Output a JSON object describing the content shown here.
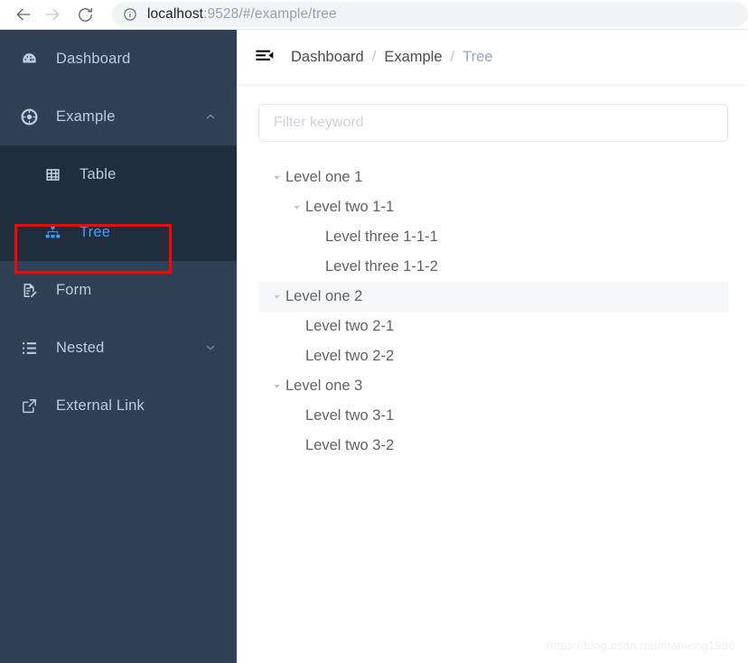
{
  "browser": {
    "back_icon": "arrow-left-icon",
    "forward_icon": "arrow-right-icon",
    "reload_icon": "reload-icon",
    "info_icon": "info-circle-icon",
    "url_host": "localhost",
    "url_rest": ":9528/#/example/tree",
    "url_full": "localhost:9528/#/example/tree"
  },
  "sidebar": {
    "background": "#304156",
    "submenu_background": "#1f2d3d",
    "active_color": "#409eff",
    "items": [
      {
        "label": "Dashboard",
        "icon": "dashboard-gauge-icon",
        "arrow": ""
      },
      {
        "label": "Example",
        "icon": "lifebuoy-icon",
        "arrow": "chevron-up-icon"
      },
      {
        "label": "Table",
        "icon": "table-grid-icon",
        "arrow": ""
      },
      {
        "label": "Tree",
        "icon": "sitemap-tree-icon",
        "arrow": ""
      },
      {
        "label": "Form",
        "icon": "document-edit-icon",
        "arrow": ""
      },
      {
        "label": "Nested",
        "icon": "nested-list-icon",
        "arrow": "chevron-down-icon"
      },
      {
        "label": "External Link",
        "icon": "external-link-icon",
        "arrow": ""
      }
    ],
    "annotation_color": "#ff0000"
  },
  "navbar": {
    "hamburger_icon": "menu-collapse-icon",
    "breadcrumb": [
      {
        "label": "Dashboard",
        "current": false
      },
      {
        "label": "Example",
        "current": false
      },
      {
        "label": "Tree",
        "current": true
      }
    ],
    "separator": "/"
  },
  "filter": {
    "placeholder": "Filter keyword",
    "value": ""
  },
  "tree": {
    "nodes": [
      {
        "label": "Level one 1",
        "depth": 1,
        "expandable": true,
        "highlight": false
      },
      {
        "label": "Level two 1-1",
        "depth": 2,
        "expandable": true,
        "highlight": false
      },
      {
        "label": "Level three 1-1-1",
        "depth": 3,
        "expandable": false,
        "highlight": false
      },
      {
        "label": "Level three 1-1-2",
        "depth": 3,
        "expandable": false,
        "highlight": false
      },
      {
        "label": "Level one 2",
        "depth": 1,
        "expandable": true,
        "highlight": true
      },
      {
        "label": "Level two 2-1",
        "depth": 2,
        "expandable": false,
        "highlight": false
      },
      {
        "label": "Level two 2-2",
        "depth": 2,
        "expandable": false,
        "highlight": false
      },
      {
        "label": "Level one 3",
        "depth": 1,
        "expandable": true,
        "highlight": false
      },
      {
        "label": "Level two 3-1",
        "depth": 2,
        "expandable": false,
        "highlight": false
      },
      {
        "label": "Level two 3-2",
        "depth": 2,
        "expandable": false,
        "highlight": false
      }
    ]
  },
  "watermark": {
    "text": "https://blog.csdn.net/mameng1988"
  }
}
